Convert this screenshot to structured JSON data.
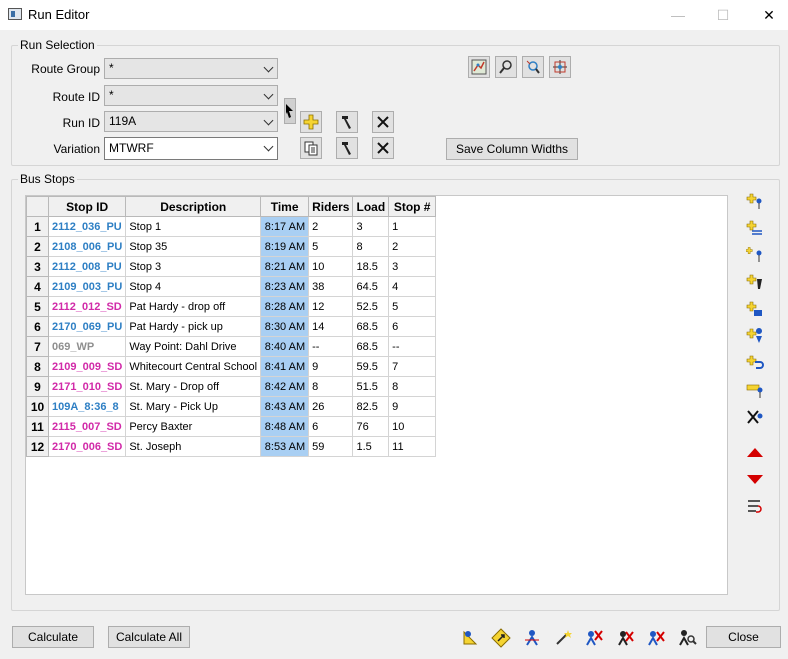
{
  "window": {
    "title": "Run Editor",
    "minimize": "—",
    "maximize": "☐",
    "close": "✕"
  },
  "run_selection": {
    "legend": "Run Selection",
    "route_group_label": "Route Group",
    "route_group_value": "*",
    "route_id_label": "Route ID",
    "route_id_value": "*",
    "run_id_label": "Run ID",
    "run_id_value": "119A",
    "variation_label": "Variation",
    "variation_value": "MTWRF",
    "save_column_widths": "Save Column Widths"
  },
  "bus_stops": {
    "legend": "Bus Stops",
    "columns": [
      "Stop ID",
      "Description",
      "Time",
      "Riders",
      "Load",
      "Stop #"
    ],
    "rows": [
      {
        "n": "1",
        "stop_id": "2112_036_PU",
        "color": "blue",
        "desc": "Stop 1",
        "time": "8:17 AM",
        "riders": "2",
        "load": "3",
        "stop_no": "1"
      },
      {
        "n": "2",
        "stop_id": "2108_006_PU",
        "color": "blue",
        "desc": "Stop 35",
        "time": "8:19 AM",
        "riders": "5",
        "load": "8",
        "stop_no": "2"
      },
      {
        "n": "3",
        "stop_id": "2112_008_PU",
        "color": "blue",
        "desc": "Stop 3",
        "time": "8:21 AM",
        "riders": "10",
        "load": "18.5",
        "stop_no": "3"
      },
      {
        "n": "4",
        "stop_id": "2109_003_PU",
        "color": "blue",
        "desc": "Stop 4",
        "time": "8:23 AM",
        "riders": "38",
        "load": "64.5",
        "stop_no": "4"
      },
      {
        "n": "5",
        "stop_id": "2112_012_SD",
        "color": "magenta",
        "desc": "Pat Hardy - drop off",
        "time": "8:28 AM",
        "riders": "12",
        "load": "52.5",
        "stop_no": "5"
      },
      {
        "n": "6",
        "stop_id": "2170_069_PU",
        "color": "blue",
        "desc": "Pat Hardy - pick up",
        "time": "8:30 AM",
        "riders": "14",
        "load": "68.5",
        "stop_no": "6"
      },
      {
        "n": "7",
        "stop_id": "069_WP",
        "color": "grey",
        "desc": "Way Point: Dahl Drive",
        "time": "8:40 AM",
        "riders": "--",
        "load": "68.5",
        "stop_no": "--"
      },
      {
        "n": "8",
        "stop_id": "2109_009_SD",
        "color": "magenta",
        "desc": "Whitecourt Central School",
        "time": "8:41 AM",
        "riders": "9",
        "load": "59.5",
        "stop_no": "7"
      },
      {
        "n": "9",
        "stop_id": "2171_010_SD",
        "color": "magenta",
        "desc": "St. Mary - Drop off",
        "time": "8:42 AM",
        "riders": "8",
        "load": "51.5",
        "stop_no": "8"
      },
      {
        "n": "10",
        "stop_id": "109A_8:36_8",
        "color": "blue",
        "desc": "St. Mary - Pick Up",
        "time": "8:43 AM",
        "riders": "26",
        "load": "82.5",
        "stop_no": "9"
      },
      {
        "n": "11",
        "stop_id": "2115_007_SD",
        "color": "magenta",
        "desc": "Percy Baxter",
        "time": "8:48 AM",
        "riders": "6",
        "load": "76",
        "stop_no": "10"
      },
      {
        "n": "12",
        "stop_id": "2170_006_SD",
        "color": "magenta",
        "desc": "St. Joseph",
        "time": "8:53 AM",
        "riders": "59",
        "load": "1.5",
        "stop_no": "11"
      }
    ]
  },
  "footer": {
    "calculate": "Calculate",
    "calculate_all": "Calculate All",
    "close": "Close"
  },
  "colors": {
    "time_cell": "#a9cff3",
    "pickup_id": "#2e7fc4",
    "dropoff_id": "#d12aa8",
    "waypoint_id": "#8f8f8f",
    "arrow_red": "#d40000"
  }
}
